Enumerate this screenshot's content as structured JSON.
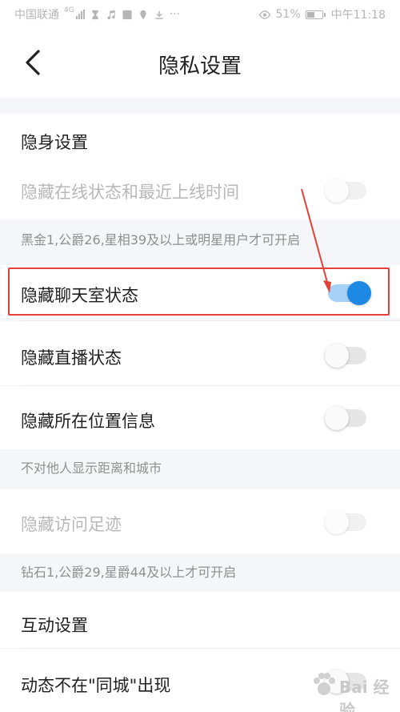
{
  "status_bar": {
    "carrier": "中国联通",
    "network": "4G",
    "battery_percent": "51%",
    "battery_level": 0.51,
    "time": "中午11:18"
  },
  "nav": {
    "title": "隐私设置"
  },
  "sections": {
    "stealth_header": "隐身设置",
    "interaction_header": "互动设置"
  },
  "rows": {
    "hide_online": {
      "label": "隐藏在线状态和最近上线时间",
      "on": false,
      "disabled": true
    },
    "hide_chatroom": {
      "label": "隐藏聊天室状态",
      "on": true,
      "disabled": false
    },
    "hide_live": {
      "label": "隐藏直播状态",
      "on": false,
      "disabled": false
    },
    "hide_location": {
      "label": "隐藏所在位置信息",
      "on": false,
      "disabled": false
    },
    "hide_visit": {
      "label": "隐藏访问足迹",
      "on": false,
      "disabled": true
    },
    "not_in_city": {
      "label": "动态不在\"同城\"出现",
      "on": false,
      "disabled": false
    }
  },
  "notes": {
    "online_note": "黑金1,公爵26,星相39及以上或明星用户才可开启",
    "location_note": "不对他人显示距离和城市",
    "visit_note": "钻石1,公爵29,星爵44及以上才可开启"
  },
  "colors": {
    "accent": "#1e88e5",
    "annotation": "#e2413a"
  },
  "watermark": {
    "text": "Bai 经验"
  }
}
